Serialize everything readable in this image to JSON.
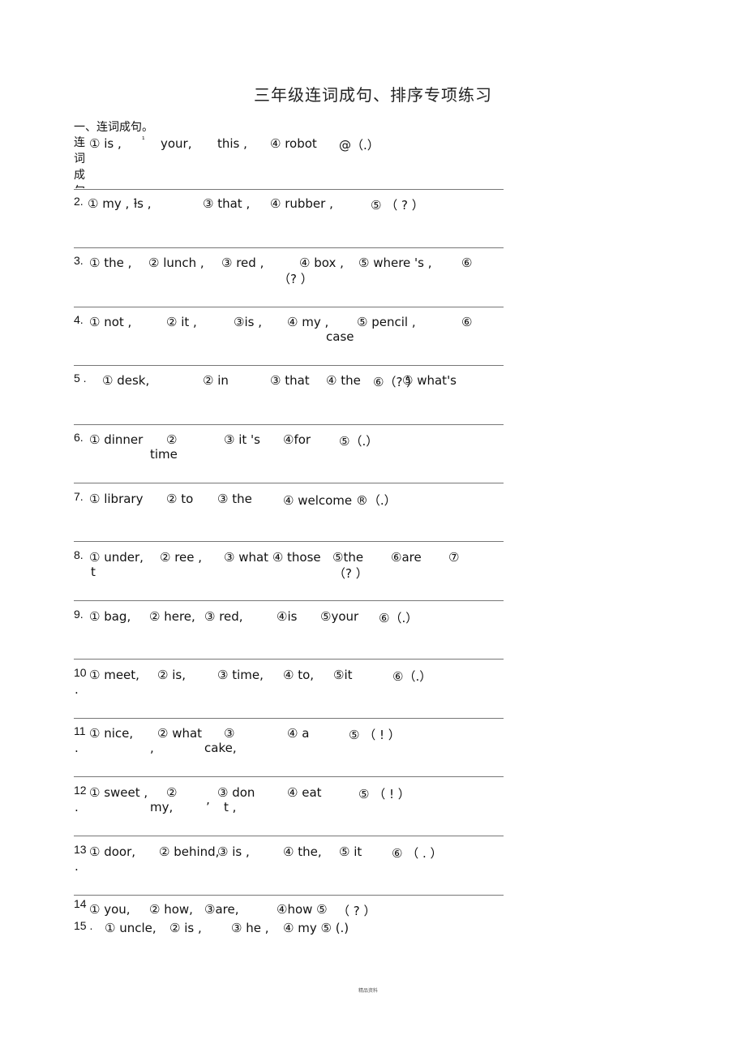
{
  "title": "三年级连词成句、排序专项练习",
  "section_heading": "一、连词成句。",
  "side_label": [
    "连",
    "词",
    "成",
    "句"
  ],
  "questions": [
    {
      "num": "",
      "tokens": [
        "① is ,",
        "¹",
        "your,",
        "this ,",
        "④ robot",
        "@（.）"
      ]
    },
    {
      "num": "2.",
      "tokens": [
        "① my , ¹",
        "is ,",
        "③ that ,",
        "④ rubber ,",
        "⑤ （ ? ）"
      ]
    },
    {
      "num": "3.",
      "tokens": [
        "① the ,",
        "② lunch ,",
        "③ red ,",
        "④ box ,",
        "⑤ where 's ,",
        "⑥"
      ],
      "line2": [
        "（? ）"
      ]
    },
    {
      "num": "4.",
      "tokens": [
        "① not ,",
        "② it ,",
        "③is ,",
        "④ my ,",
        "⑤ pencil ,",
        "⑥"
      ],
      "line2": [
        "case"
      ]
    },
    {
      "num": "5 .",
      "tokens": [
        "① desk,",
        "② in",
        "③ that",
        "④ the",
        "⑤ what's",
        "⑥（? ）"
      ]
    },
    {
      "num": "6.",
      "tokens": [
        "① dinner",
        "②",
        "③ it 's",
        "④for",
        "⑤（.）"
      ],
      "line2": [
        "time"
      ]
    },
    {
      "num": "7.",
      "tokens": [
        "① library",
        "② to",
        "③ the",
        "④ welcome ®（.）"
      ]
    },
    {
      "num": "8.",
      "tokens": [
        "① under,",
        "② ree ,",
        "③ what ④ those",
        "⑤the",
        "⑥are",
        "⑦"
      ],
      "line2": [
        "t",
        "（? ）"
      ]
    },
    {
      "num": "9.",
      "tokens": [
        "① bag,",
        "② here,",
        "③ red,",
        "④is",
        "⑤your",
        "⑥（.）"
      ]
    },
    {
      "num": "10",
      "tokens": [
        "① meet,",
        "② is,",
        "③ time,",
        "④ to,",
        "⑤it",
        "⑥（.）"
      ],
      "line2": [
        "."
      ]
    },
    {
      "num": "11",
      "tokens": [
        "① nice,",
        "② what",
        "③",
        "④ a",
        "⑤ （ ! ）"
      ],
      "line2": [
        ".",
        ",",
        "cake,"
      ]
    },
    {
      "num": "12",
      "tokens": [
        "① sweet ,",
        "②",
        "③ don",
        "④ eat",
        "⑤ （ ! ）"
      ],
      "line2": [
        ".",
        "my,",
        "’",
        "t ,"
      ]
    },
    {
      "num": "13",
      "tokens": [
        "① door,",
        "② behind,",
        "③ is ,",
        "④ the,",
        "⑤ it",
        "⑥ （ . ）"
      ],
      "line2": [
        "."
      ]
    },
    {
      "num": "14",
      "tokens": [
        "① you,",
        "② how,",
        "③are,",
        "④how ⑤",
        "（ ? ）"
      ]
    },
    {
      "num": "15 .",
      "tokens": [
        "① uncle,",
        "② is ,",
        "③ he ,",
        "④ my ⑤ (.)"
      ]
    }
  ],
  "footer": "精品资料"
}
